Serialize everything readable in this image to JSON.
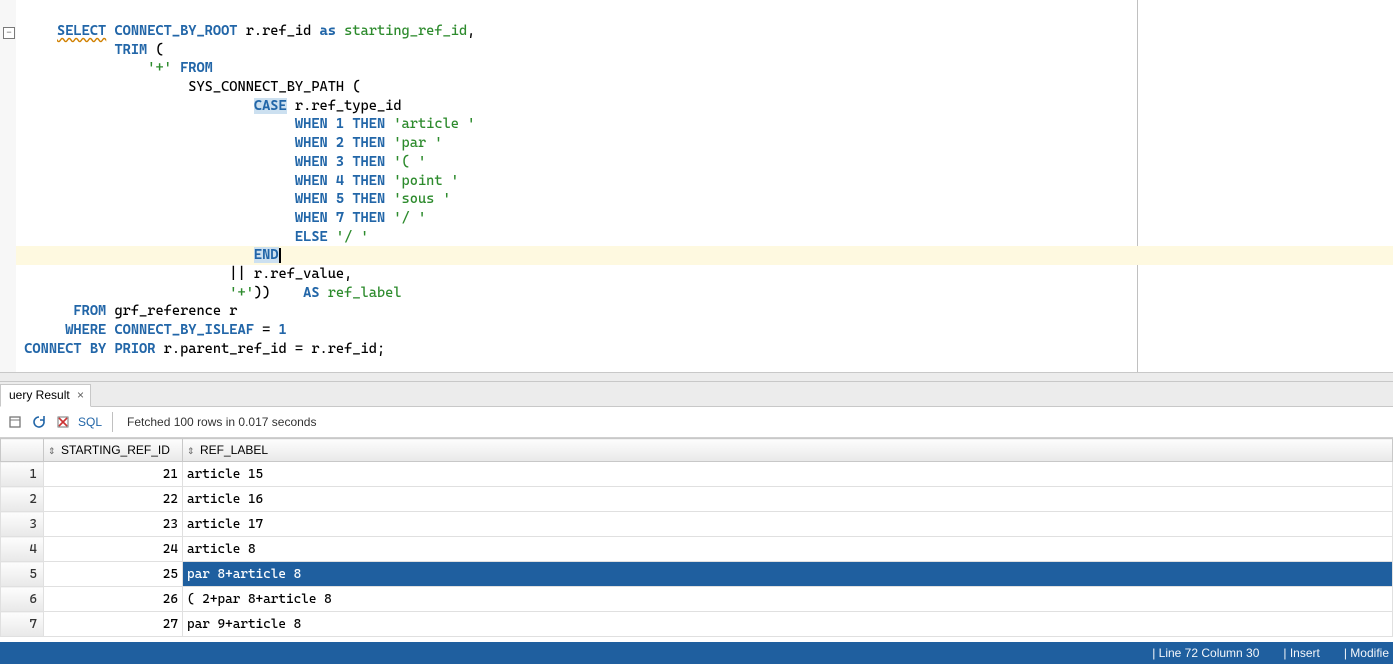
{
  "editor": {
    "fold_glyph": "−",
    "lines": [
      {
        "tokens": [
          {
            "t": "     "
          },
          {
            "t": "SELECT",
            "c": "kw wavy"
          },
          {
            "t": " "
          },
          {
            "t": "CONNECT_BY_ROOT",
            "c": "kw"
          },
          {
            "t": " r.ref_id "
          },
          {
            "t": "as",
            "c": "kw2"
          },
          {
            "t": " "
          },
          {
            "t": "starting_ref_id",
            "c": "alias"
          },
          {
            "t": ","
          }
        ]
      },
      {
        "tokens": [
          {
            "t": "            "
          },
          {
            "t": "TRIM",
            "c": "kw"
          },
          {
            "t": " ("
          }
        ]
      },
      {
        "tokens": [
          {
            "t": "                "
          },
          {
            "t": "'+'",
            "c": "str"
          },
          {
            "t": " "
          },
          {
            "t": "FROM",
            "c": "kw"
          }
        ]
      },
      {
        "tokens": [
          {
            "t": "                     SYS_CONNECT_BY_PATH ("
          }
        ]
      },
      {
        "tokens": [
          {
            "t": "                             "
          },
          {
            "t": "CASE",
            "c": "kw kw-box"
          },
          {
            "t": " r.ref_type_id"
          }
        ]
      },
      {
        "tokens": [
          {
            "t": "                                  "
          },
          {
            "t": "WHEN",
            "c": "kw"
          },
          {
            "t": " "
          },
          {
            "t": "1",
            "c": "num"
          },
          {
            "t": " "
          },
          {
            "t": "THEN",
            "c": "kw"
          },
          {
            "t": " "
          },
          {
            "t": "'article '",
            "c": "str"
          }
        ]
      },
      {
        "tokens": [
          {
            "t": "                                  "
          },
          {
            "t": "WHEN",
            "c": "kw"
          },
          {
            "t": " "
          },
          {
            "t": "2",
            "c": "num"
          },
          {
            "t": " "
          },
          {
            "t": "THEN",
            "c": "kw"
          },
          {
            "t": " "
          },
          {
            "t": "'par '",
            "c": "str"
          }
        ]
      },
      {
        "tokens": [
          {
            "t": "                                  "
          },
          {
            "t": "WHEN",
            "c": "kw"
          },
          {
            "t": " "
          },
          {
            "t": "3",
            "c": "num"
          },
          {
            "t": " "
          },
          {
            "t": "THEN",
            "c": "kw"
          },
          {
            "t": " "
          },
          {
            "t": "'( '",
            "c": "str"
          }
        ]
      },
      {
        "tokens": [
          {
            "t": "                                  "
          },
          {
            "t": "WHEN",
            "c": "kw"
          },
          {
            "t": " "
          },
          {
            "t": "4",
            "c": "num"
          },
          {
            "t": " "
          },
          {
            "t": "THEN",
            "c": "kw"
          },
          {
            "t": " "
          },
          {
            "t": "'point '",
            "c": "str"
          }
        ]
      },
      {
        "tokens": [
          {
            "t": "                                  "
          },
          {
            "t": "WHEN",
            "c": "kw"
          },
          {
            "t": " "
          },
          {
            "t": "5",
            "c": "num"
          },
          {
            "t": " "
          },
          {
            "t": "THEN",
            "c": "kw"
          },
          {
            "t": " "
          },
          {
            "t": "'sous '",
            "c": "str"
          }
        ]
      },
      {
        "tokens": [
          {
            "t": "                                  "
          },
          {
            "t": "WHEN",
            "c": "kw"
          },
          {
            "t": " "
          },
          {
            "t": "7",
            "c": "num"
          },
          {
            "t": " "
          },
          {
            "t": "THEN",
            "c": "kw"
          },
          {
            "t": " "
          },
          {
            "t": "'/ '",
            "c": "str"
          }
        ]
      },
      {
        "tokens": [
          {
            "t": "                                  "
          },
          {
            "t": "ELSE",
            "c": "kw"
          },
          {
            "t": " "
          },
          {
            "t": "'/ '",
            "c": "str"
          }
        ]
      },
      {
        "hl": true,
        "cursor_after": 1,
        "tokens": [
          {
            "t": "                             "
          },
          {
            "t": "END",
            "c": "kw kw-box"
          }
        ]
      },
      {
        "tokens": [
          {
            "t": "                          || r.ref_value,"
          }
        ]
      },
      {
        "tokens": [
          {
            "t": "                          "
          },
          {
            "t": "'+'",
            "c": "str"
          },
          {
            "t": "))    "
          },
          {
            "t": "AS",
            "c": "kw"
          },
          {
            "t": " "
          },
          {
            "t": "ref_label",
            "c": "alias"
          }
        ]
      },
      {
        "tokens": [
          {
            "t": "       "
          },
          {
            "t": "FROM",
            "c": "kw"
          },
          {
            "t": " grf_reference r"
          }
        ]
      },
      {
        "tokens": [
          {
            "t": "      "
          },
          {
            "t": "WHERE",
            "c": "kw"
          },
          {
            "t": " "
          },
          {
            "t": "CONNECT_BY_ISLEAF",
            "c": "kw"
          },
          {
            "t": " = "
          },
          {
            "t": "1",
            "c": "num"
          }
        ]
      },
      {
        "tokens": [
          {
            "t": " "
          },
          {
            "t": "CONNECT",
            "c": "kw"
          },
          {
            "t": " "
          },
          {
            "t": "BY",
            "c": "kw"
          },
          {
            "t": " "
          },
          {
            "t": "PRIOR",
            "c": "kw"
          },
          {
            "t": " r.parent_ref_id = r.ref_id;"
          }
        ]
      }
    ]
  },
  "results": {
    "tab_label": "uery Result",
    "tab_close_glyph": "×",
    "sql_label": "SQL",
    "fetch_status": "Fetched 100 rows in 0.017 seconds",
    "columns": [
      {
        "label": "STARTING_REF_ID"
      },
      {
        "label": "REF_LABEL"
      }
    ],
    "rows": [
      {
        "n": "1",
        "id": "21",
        "label": "article 15"
      },
      {
        "n": "2",
        "id": "22",
        "label": "article 16"
      },
      {
        "n": "3",
        "id": "23",
        "label": "article 17"
      },
      {
        "n": "4",
        "id": "24",
        "label": "article 8"
      },
      {
        "n": "5",
        "id": "25",
        "label": "par 8+article 8",
        "selected": true
      },
      {
        "n": "6",
        "id": "26",
        "label": "( 2+par 8+article 8"
      },
      {
        "n": "7",
        "id": "27",
        "label": "par 9+article 8"
      }
    ]
  },
  "statusbar": {
    "pos": "| Line 72 Column 30",
    "insert": "| Insert",
    "modified": "| Modifie"
  }
}
